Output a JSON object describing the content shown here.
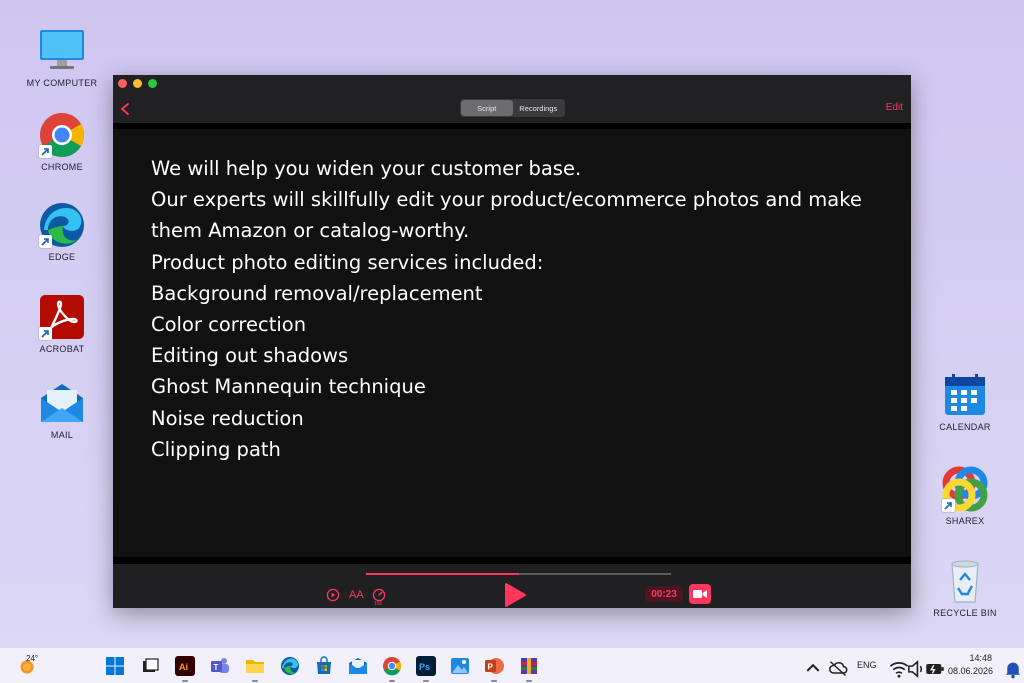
{
  "desktop": {
    "icons": [
      {
        "label": "MY COMPUTER"
      },
      {
        "label": "CHROME"
      },
      {
        "label": "EDGE"
      },
      {
        "label": "ACROBAT"
      },
      {
        "label": "MAIL"
      },
      {
        "label": "CALENDAR"
      },
      {
        "label": "SHAREX"
      },
      {
        "label": "RECYCLE BIN"
      }
    ]
  },
  "app": {
    "tabs": [
      {
        "label": "Script",
        "active": true
      },
      {
        "label": "Recordings",
        "active": false
      }
    ],
    "edit_label": "Edit",
    "accent_color": "#ff375f",
    "script_lines": [
      "We will help you widen your customer base.",
      "Our experts will skillfully edit your product/ecommerce photos and make",
      "them Amazon or catalog-worthy.",
      "Product photo editing services included:",
      "Background removal/replacement",
      "Color correction",
      "Editing out shadows",
      "Ghost Mannequin technique",
      "Noise reduction",
      "Clipping path"
    ],
    "controls": {
      "text_size_label": "AA",
      "speed_value": "150",
      "progress_fraction": 0.5,
      "timer": "00:23"
    }
  },
  "taskbar": {
    "weather_temp": "24°",
    "language": "ENG",
    "time": "14:48",
    "date": "08.06.2026",
    "pinned_apps": [
      "windows-start",
      "task-view",
      "illustrator",
      "teams",
      "file-explorer",
      "edge",
      "microsoft-store",
      "mail",
      "chrome",
      "photoshop",
      "photos",
      "powerpoint",
      "winrar"
    ]
  }
}
